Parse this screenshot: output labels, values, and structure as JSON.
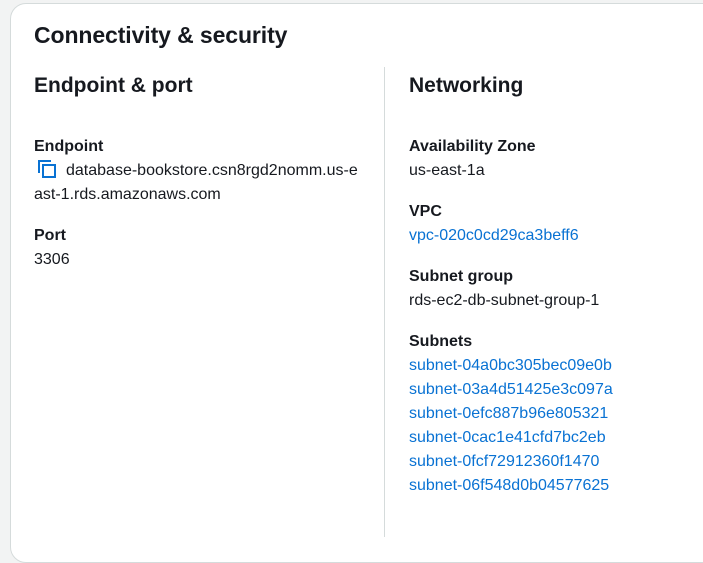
{
  "section": {
    "title": "Connectivity & security"
  },
  "endpoint_port": {
    "title": "Endpoint & port",
    "endpoint_label": "Endpoint",
    "endpoint_value": "database-bookstore.csn8rgd2nomm.us-east-1.rds.amazonaws.com",
    "copy_icon": "copy-icon",
    "port_label": "Port",
    "port_value": "3306"
  },
  "networking": {
    "title": "Networking",
    "az_label": "Availability Zone",
    "az_value": "us-east-1a",
    "vpc_label": "VPC",
    "vpc_value": "vpc-020c0cd29ca3beff6",
    "subnet_group_label": "Subnet group",
    "subnet_group_value": "rds-ec2-db-subnet-group-1",
    "subnets_label": "Subnets",
    "subnets": [
      "subnet-04a0bc305bec09e0b",
      "subnet-03a4d51425e3c097a",
      "subnet-0efc887b96e805321",
      "subnet-0cac1e41cfd7bc2eb",
      "subnet-0fcf72912360f1470",
      "subnet-06f548d0b04577625"
    ]
  },
  "colors": {
    "link": "#0972d3",
    "text": "#16191f",
    "border": "#d5dbdb"
  }
}
